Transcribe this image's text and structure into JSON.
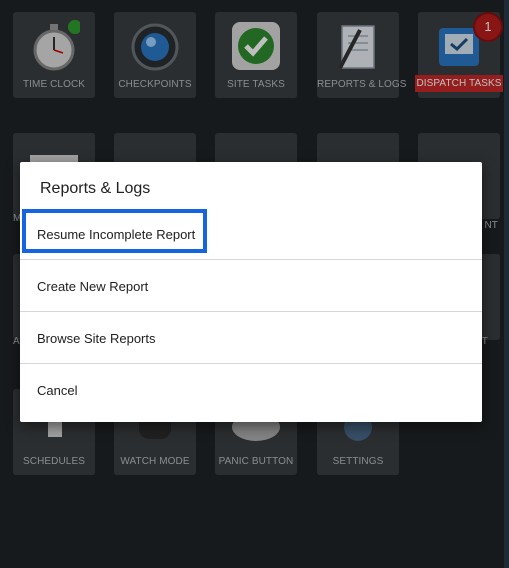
{
  "tiles": {
    "time_clock": "TIME CLOCK",
    "checkpoints": "CHECKPOINTS",
    "site_tasks": "SITE TASKS",
    "reports_logs": "REPORTS & LOGS",
    "dispatch_tasks": "DISPATCH TASKS",
    "dispatch_badge": "1",
    "row2_left_partial": "M",
    "row2_right_partial": "NT",
    "row3_left_partial": "A",
    "row3_right_partial": "T",
    "schedules": "SCHEDULES",
    "watch_mode": "WATCH MODE",
    "panic_button": "PANIC BUTTON",
    "settings": "SETTINGS"
  },
  "dialog": {
    "title": "Reports & Logs",
    "options": [
      "Resume Incomplete Report",
      "Create New Report",
      "Browse Site Reports",
      "Cancel"
    ]
  },
  "colors": {
    "background": "#1f2326",
    "tile": "#3a3e41",
    "dispatch_label_bg": "#c62828",
    "focus_border": "#1565e0"
  }
}
